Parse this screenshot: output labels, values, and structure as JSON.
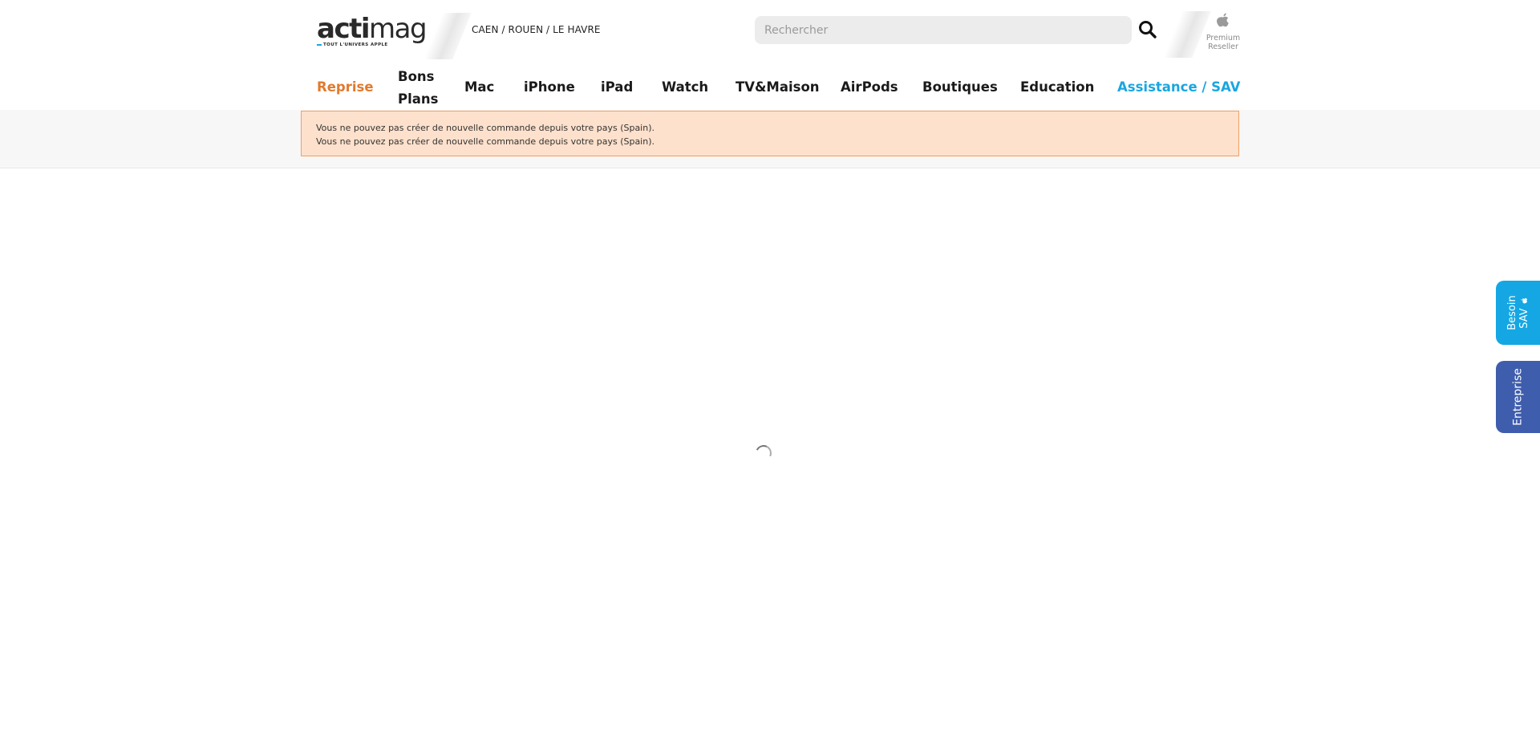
{
  "brand": {
    "name_bold": "acti",
    "name_light": "mag",
    "tagline": "TOUT L'UNIVERS APPLE"
  },
  "header": {
    "cities": "CAEN / ROUEN / LE HAVRE",
    "search": {
      "placeholder": "Rechercher",
      "value": ""
    },
    "reseller": {
      "line1": "Premium",
      "line2": "Reseller"
    }
  },
  "nav": {
    "items": [
      {
        "label": "Reprise",
        "color": "#e07a2e"
      },
      {
        "label": "Bons",
        "label2": "Plans"
      },
      {
        "label": "Mac"
      },
      {
        "label": "iPhone"
      },
      {
        "label": "iPad"
      },
      {
        "label": "Watch"
      },
      {
        "label": "TV&Maison"
      },
      {
        "label": "AirPods"
      },
      {
        "label": "Boutiques"
      },
      {
        "label": "Education"
      },
      {
        "label": "Assistance / SAV",
        "color": "#1aa6e0"
      }
    ]
  },
  "alert": {
    "messages": [
      "Vous ne pouvez pas créer de nouvelle commande depuis votre pays (Spain).",
      "Vous ne pouvez pas créer de nouvelle commande depuis votre pays (Spain)."
    ],
    "background": "#fde1cc",
    "border": "#f0a063"
  },
  "side_tabs": {
    "sav": {
      "line1": "Besoin",
      "line2": "SAV",
      "icon": "apple-icon",
      "color": "#14a7e3"
    },
    "enterprise": {
      "label": "Entreprise",
      "color": "#3f5dad"
    }
  },
  "icons": {
    "search": "search-icon",
    "apple": "apple-icon",
    "loading": "loading-spinner"
  }
}
